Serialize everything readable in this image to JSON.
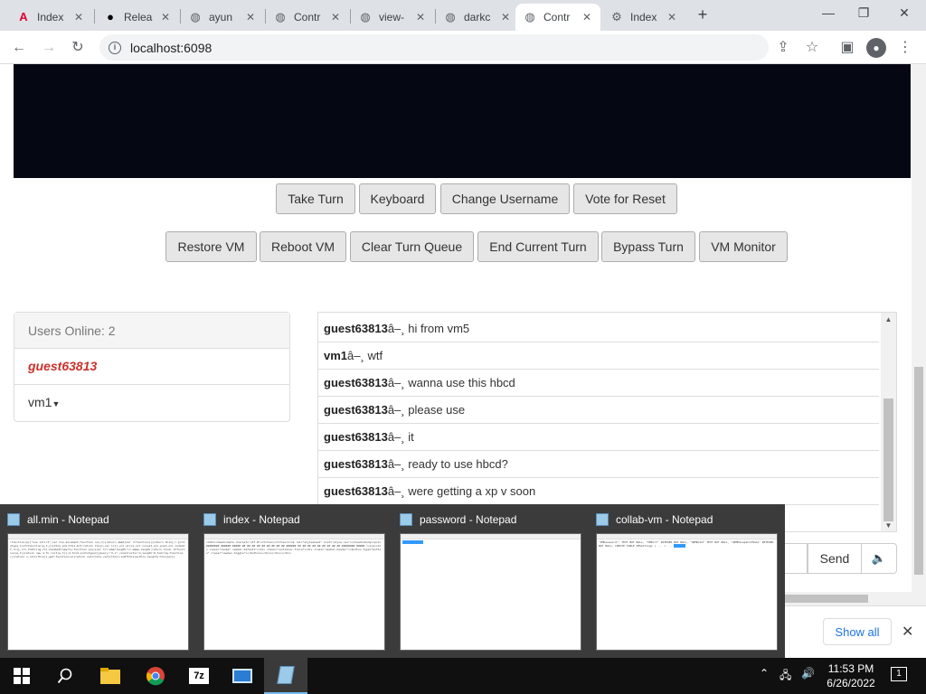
{
  "browser": {
    "tabs": [
      {
        "label": "Index",
        "icon": "angular-icon",
        "active": false
      },
      {
        "label": "Relea",
        "icon": "github-icon",
        "active": false
      },
      {
        "label": "ayun",
        "icon": "globe-icon",
        "active": false
      },
      {
        "label": "Contr",
        "icon": "globe-icon",
        "active": false
      },
      {
        "label": "view-",
        "icon": "globe-icon",
        "active": false
      },
      {
        "label": "darkc",
        "icon": "globe-icon",
        "active": false
      },
      {
        "label": "Contr",
        "icon": "globe-icon",
        "active": true
      },
      {
        "label": "Index",
        "icon": "collabvm-icon",
        "active": false
      }
    ],
    "url": "localhost:6098"
  },
  "controls": {
    "row1": [
      "Take Turn",
      "Keyboard",
      "Change Username",
      "Vote for Reset"
    ],
    "row2": [
      "Restore VM",
      "Reboot VM",
      "Clear Turn Queue",
      "End Current Turn",
      "Bypass Turn",
      "VM Monitor"
    ]
  },
  "users": {
    "header": "Users Online: 2",
    "list": [
      {
        "name": "guest63813",
        "self": true
      },
      {
        "name": "vm1",
        "dropdown": true
      }
    ]
  },
  "chat": {
    "separator": "â–¸",
    "messages": [
      {
        "user": "guest63813",
        "text": "hi from vm5"
      },
      {
        "user": "vm1",
        "text": "wtf"
      },
      {
        "user": "guest63813",
        "text": "wanna use this hbcd"
      },
      {
        "user": "guest63813",
        "text": "please use"
      },
      {
        "user": "guest63813",
        "text": "it"
      },
      {
        "user": "guest63813",
        "text": "ready to use hbcd?"
      },
      {
        "user": "guest63813",
        "text": "were getting a xp v soon"
      },
      {
        "user": "guest63813",
        "text": ""
      }
    ],
    "send_label": "Send"
  },
  "downloads": {
    "show_all": "Show all"
  },
  "thumbnails": [
    {
      "title": "all.min - Notepad"
    },
    {
      "title": "index - Notepad"
    },
    {
      "title": "password - Notepad"
    },
    {
      "title": "collab-vm - Notepad"
    }
  ],
  "taskbar": {
    "time": "11:53 PM",
    "date": "6/26/2022",
    "notifications": "1"
  }
}
